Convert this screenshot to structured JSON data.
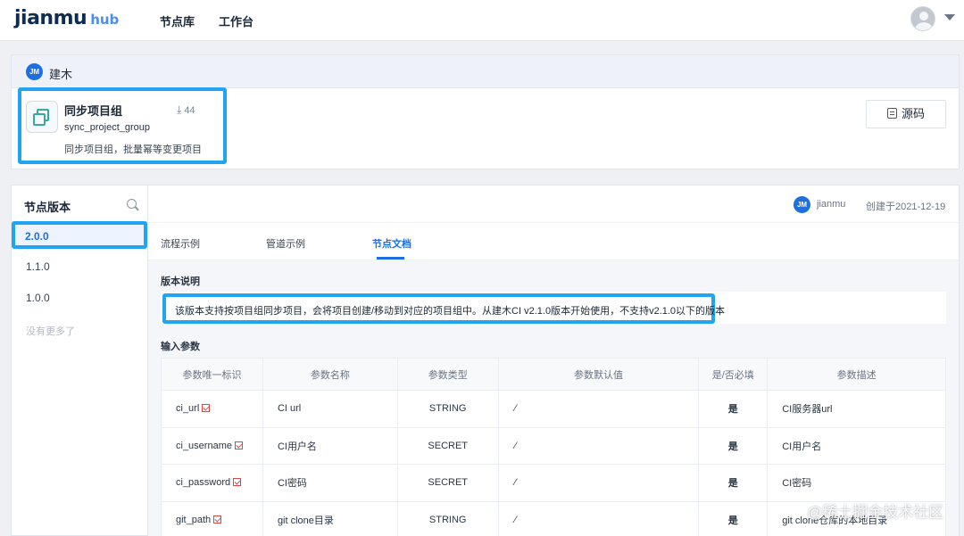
{
  "nav": {
    "logo_main": "jianmu",
    "logo_sub": "hub",
    "links": [
      "节点库",
      "工作台"
    ]
  },
  "owner": {
    "badge": "JM",
    "name": "建木"
  },
  "node": {
    "title": "同步项目组",
    "downloads": "44",
    "ref": "sync_project_group",
    "description": "同步项目组，批量幂等变更项目",
    "source_button": "源码"
  },
  "versions": {
    "title": "节点版本",
    "items": [
      "2.0.0",
      "1.1.0",
      "1.0.0"
    ],
    "active": "2.0.0",
    "no_more": "没有更多了"
  },
  "meta": {
    "badge": "JM",
    "user": "jianmu",
    "created": "创建于2021-12-19"
  },
  "tabs": [
    "流程示例",
    "管道示例",
    "节点文档"
  ],
  "doc": {
    "version_section": "版本说明",
    "version_note": "该版本支持按项目组同步项目，会将项目创建/移动到对应的项目组中。从建木CI v2.1.0版本开始使用，不支持v2.1.0以下的版本",
    "input_section": "输入参数",
    "columns": [
      "参数唯一标识",
      "参数名称",
      "参数类型",
      "参数默认值",
      "是/否必填",
      "参数描述"
    ],
    "rows": [
      {
        "key": "ci_url",
        "name": "CI url",
        "type": "STRING",
        "default": "⁄",
        "required": "是",
        "desc": "CI服务器url"
      },
      {
        "key": "ci_username",
        "name": "CI用户名",
        "type": "SECRET",
        "default": "⁄",
        "required": "是",
        "desc": "CI用户名"
      },
      {
        "key": "ci_password",
        "name": "CI密码",
        "type": "SECRET",
        "default": "⁄",
        "required": "是",
        "desc": "CI密码"
      },
      {
        "key": "git_path",
        "name": "git clone目录",
        "type": "STRING",
        "default": "⁄",
        "required": "是",
        "desc": "git clone仓库的本地目录"
      }
    ]
  },
  "watermark": "@稀土掘金技术社区",
  "colors": {
    "accent": "#1d6fe0",
    "highlight_border": "#22a5f0",
    "required": "#e23b3b"
  }
}
